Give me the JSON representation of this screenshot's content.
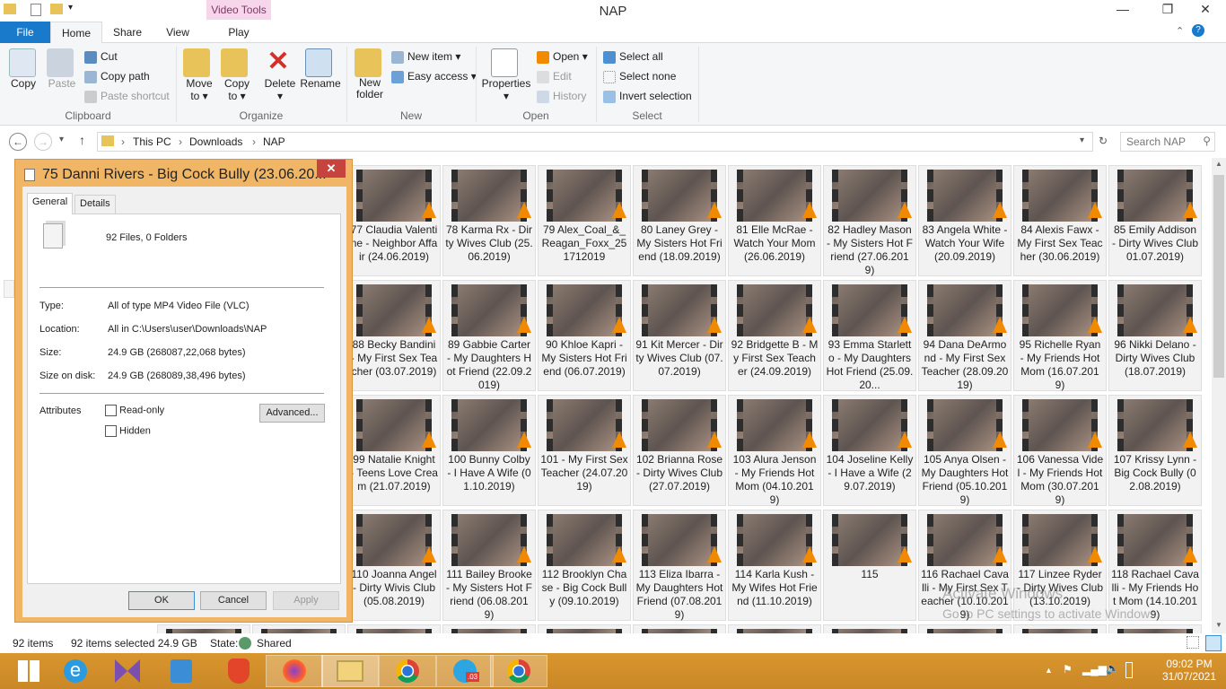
{
  "window": {
    "title": "NAP",
    "context_tab": "Video Tools",
    "min": "—",
    "max": "❐",
    "close": "✕"
  },
  "tabs": [
    "File",
    "Home",
    "Share",
    "View",
    "Play"
  ],
  "ribbon": {
    "clipboard": {
      "copy": "Copy",
      "paste": "Paste",
      "cut": "Cut",
      "copy_path": "Copy path",
      "paste_shortcut": "Paste shortcut",
      "group": "Clipboard"
    },
    "organize": {
      "move_to": "Move to ▾",
      "copy_to": "Copy to ▾",
      "delete": "Delete ▾",
      "rename": "Rename",
      "group": "Organize"
    },
    "new": {
      "new_folder": "New folder",
      "new_item": "New item ▾",
      "easy_access": "Easy access ▾",
      "group": "New"
    },
    "open": {
      "properties": "Properties ▾",
      "open": "Open ▾",
      "edit": "Edit",
      "history": "History",
      "group": "Open"
    },
    "select": {
      "select_all": "Select all",
      "select_none": "Select none",
      "invert": "Invert selection",
      "group": "Select"
    }
  },
  "address": {
    "crumbs": [
      "This PC",
      "Downloads",
      "NAP"
    ],
    "search_placeholder": "Search NAP"
  },
  "items": [
    "77 Claudia Valentine - Neighbor Affair (24.06.2019)",
    "78 Karma Rx - Dirty Wives Club (25.06.2019)",
    "79 Alex_Coal_&_Reagan_Foxx_251712019",
    "80 Laney Grey - My Sisters Hot Friend (18.09.2019)",
    "81 Elle McRae - Watch Your Mom (26.06.2019)",
    "82 Hadley Mason - My Sisters Hot Friend (27.06.2019)",
    "83 Angela White - Watch Your Wife (20.09.2019)",
    "84 Alexis Fawx - My First Sex Teacher (30.06.2019)",
    "85 Emily Addison - Dirty Wives Club 01.07.2019)",
    "88 Becky Bandini - My First Sex Teacher (03.07.2019)",
    "89 Gabbie Carter - My Daughters Hot Friend (22.09.2019)",
    "90 Khloe Kapri - My Sisters Hot Friend (06.07.2019)",
    "91 Kit Mercer - Dirty Wives Club (07.07.2019)",
    "92 Bridgette B - My First Sex Teacher (24.09.2019)",
    "93 Emma Starletto - My Daughters Hot Friend (25.09.20...",
    "94 Dana DeArmond - My First Sex Teacher (28.09.2019)",
    "95 Richelle Ryan - My Friends Hot Mom (16.07.2019)",
    "96 Nikki Delano - Dirty Wives Club (18.07.2019)",
    "99 Natalie Knight - Teens Love Cream (21.07.2019)",
    "100 Bunny Colby - I Have A Wife (01.10.2019)",
    "101 - My First Sex Teacher (24.07.2019)",
    "102 Brianna Rose - Dirty Wives Club (27.07.2019)",
    "103 Alura Jenson - My Friends Hot Mom (04.10.2019)",
    "104 Joseline Kelly - I Have a Wife (29.07.2019)",
    "105 Anya Olsen - My Daughters Hot Friend (05.10.2019)",
    "106 Vanessa Videl - My Friends Hot Mom (30.07.2019)",
    "107 Krissy Lynn - Big Cock Bully (02.08.2019)",
    "110 Joanna Angel - Dirty Wivis Club (05.08.2019)",
    "111 Bailey Brooke - My Sisters Hot Friend (06.08.2019)",
    "112 Brooklyn Chase - Big Cock Bully (09.10.2019)",
    "113 Eliza Ibarra - My Daughters Hot Friend (07.08.2019)",
    "114 Karla Kush - My Wifes Hot Friend (11.10.2019)",
    "115",
    "116 Rachael Cavalli - My First Sex Teacher (10.10.2019)",
    "117 Linzee Ryder - Dirty Wives Club (13.10.2019)",
    "118 Rachael Cavalli - My Friends Hot Mom (14.10.2019)"
  ],
  "status": {
    "count": "92 items",
    "selected": "92 items selected  24.9 GB",
    "state": "State:",
    "shared": "Shared"
  },
  "watermark": {
    "line1": "Activate Windows",
    "line2": "Go to PC settings to activate Windows."
  },
  "dialog": {
    "title": "75 Danni Rivers - Big Cock Bully (23.06.20...",
    "tabs": [
      "General",
      "Details"
    ],
    "summary": "92 Files, 0 Folders",
    "type_k": "Type:",
    "type_v": "All of type MP4 Video File (VLC)",
    "loc_k": "Location:",
    "loc_v": "All in C:\\Users\\user\\Downloads\\NAP",
    "size_k": "Size:",
    "size_v": "24.9 GB (268087,22,068 bytes)",
    "disk_k": "Size on disk:",
    "disk_v": "24.9 GB (268089,38,496 bytes)",
    "attr": "Attributes",
    "readonly": "Read-only",
    "hidden": "Hidden",
    "advanced": "Advanced...",
    "ok": "OK",
    "cancel": "Cancel",
    "apply": "Apply"
  },
  "taskbar": {
    "clock": "09:02 PM",
    "date": "31/07/2021",
    "telegram_badge": ".03"
  }
}
